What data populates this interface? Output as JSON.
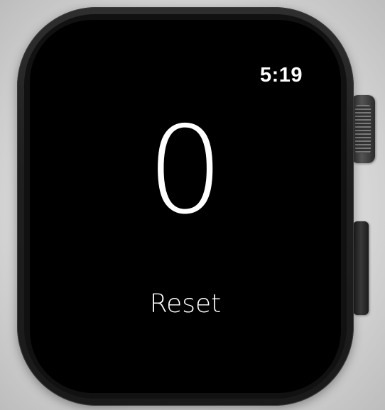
{
  "status_bar": {
    "time": "5:19"
  },
  "counter": {
    "value": "0"
  },
  "actions": {
    "reset_label": "Reset"
  },
  "colors": {
    "screen_background": "#000000",
    "text": "#ffffff",
    "case": "#1f1f1f"
  },
  "icons": {
    "digital_crown": "digital-crown-icon",
    "side_button": "side-button-icon"
  }
}
